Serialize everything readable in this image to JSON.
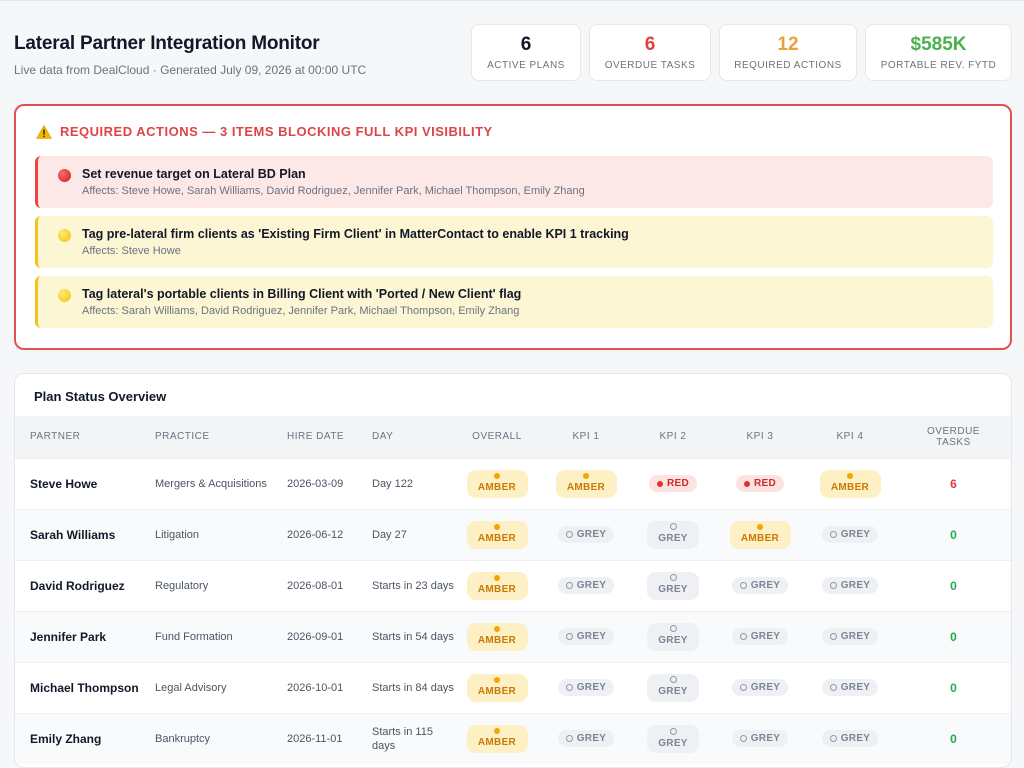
{
  "header": {
    "title": "Lateral Partner Integration Monitor",
    "subtitle": "Live data from DealCloud · Generated July 09, 2026 at 00:00 UTC"
  },
  "stats": [
    {
      "value": "6",
      "label": "Active Plans",
      "color": "#111827"
    },
    {
      "value": "6",
      "label": "Overdue Tasks",
      "color": "#e0423f"
    },
    {
      "value": "12",
      "label": "Required Actions",
      "color": "#e9a23b"
    },
    {
      "value": "$585K",
      "label": "Portable Rev. FYTD",
      "color": "#4caf50"
    }
  ],
  "required_actions": {
    "title": "Required Actions — 3 Items Blocking Full KPI Visibility",
    "icon": "warning-icon",
    "items": [
      {
        "severity": "red",
        "text": "Set revenue target on Lateral BD Plan",
        "affects": "Affects: Steve Howe, Sarah Williams, David Rodriguez, Jennifer Park, Michael Thompson, Emily Zhang"
      },
      {
        "severity": "yellow",
        "text": "Tag pre-lateral firm clients as 'Existing Firm Client' in MatterContact to enable KPI 1 tracking",
        "affects": "Affects: Steve Howe"
      },
      {
        "severity": "yellow",
        "text": "Tag lateral's portable clients in Billing Client with 'Ported / New Client' flag",
        "affects": "Affects: Sarah Williams, David Rodriguez, Jennifer Park, Michael Thompson, Emily Zhang"
      }
    ]
  },
  "table": {
    "title": "Plan Status Overview",
    "columns": [
      "Partner",
      "Practice",
      "Hire Date",
      "Day",
      "Overall",
      "KPI 1",
      "KPI 2",
      "KPI 3",
      "KPI 4",
      "Overdue Tasks"
    ],
    "rows": [
      {
        "partner": "Steve Howe",
        "practice": "Mergers & Acquisitions",
        "hire_date": "2026-03-09",
        "day": "Day 122",
        "overall": "AMBER",
        "kpi1": "AMBER",
        "kpi2": "RED",
        "kpi3": "RED",
        "kpi4": "AMBER",
        "overdue": "6"
      },
      {
        "partner": "Sarah Williams",
        "practice": "Litigation",
        "hire_date": "2026-06-12",
        "day": "Day 27",
        "overall": "AMBER",
        "kpi1": "GREY",
        "kpi2": "GREY",
        "kpi3": "AMBER",
        "kpi4": "GREY",
        "overdue": "0"
      },
      {
        "partner": "David Rodriguez",
        "practice": "Regulatory",
        "hire_date": "2026-08-01",
        "day": "Starts in 23 days",
        "overall": "AMBER",
        "kpi1": "GREY",
        "kpi2": "GREY",
        "kpi3": "GREY",
        "kpi4": "GREY",
        "overdue": "0"
      },
      {
        "partner": "Jennifer Park",
        "practice": "Fund Formation",
        "hire_date": "2026-09-01",
        "day": "Starts in 54 days",
        "overall": "AMBER",
        "kpi1": "GREY",
        "kpi2": "GREY",
        "kpi3": "GREY",
        "kpi4": "GREY",
        "overdue": "0"
      },
      {
        "partner": "Michael Thompson",
        "practice": "Legal Advisory",
        "hire_date": "2026-10-01",
        "day": "Starts in 84 days",
        "overall": "AMBER",
        "kpi1": "GREY",
        "kpi2": "GREY",
        "kpi3": "GREY",
        "kpi4": "GREY",
        "overdue": "0"
      },
      {
        "partner": "Emily Zhang",
        "practice": "Bankruptcy",
        "hire_date": "2026-11-01",
        "day": "Starts in 115 days",
        "overall": "AMBER",
        "kpi1": "GREY",
        "kpi2": "GREY",
        "kpi3": "GREY",
        "kpi4": "GREY",
        "overdue": "0"
      }
    ]
  }
}
